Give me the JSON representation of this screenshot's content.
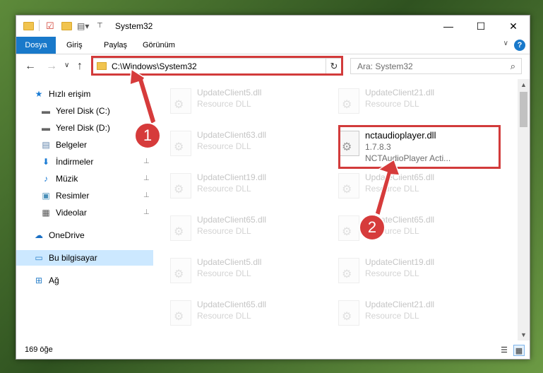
{
  "window": {
    "title": "System32",
    "minimize_glyph": "—",
    "maximize_glyph": "☐",
    "close_glyph": "✕"
  },
  "ribbon": {
    "tabs": [
      "Dosya",
      "Giriş",
      "Paylaş",
      "Görünüm"
    ],
    "help_glyph": "?",
    "toggle_glyph": "∨"
  },
  "navigation": {
    "back_glyph": "←",
    "forward_glyph": "→",
    "recent_glyph": "∨",
    "up_glyph": "↑",
    "address": "C:\\Windows\\System32",
    "address_chevron": "∨",
    "refresh_glyph": "↻",
    "search_placeholder": "Ara: System32",
    "search_glyph": "⌕"
  },
  "sidebar": {
    "items": [
      {
        "label": "Hızlı erişim",
        "icon": "star-icon",
        "glyph": "★",
        "pinned": false
      },
      {
        "label": "Yerel Disk (C:)",
        "icon": "drive-icon",
        "glyph": "▬",
        "pinned": true
      },
      {
        "label": "Yerel Disk (D:)",
        "icon": "drive-icon",
        "glyph": "▬",
        "pinned": false
      },
      {
        "label": "Belgeler",
        "icon": "documents-icon",
        "glyph": "▤",
        "pinned": true
      },
      {
        "label": "İndirmeler",
        "icon": "download-icon",
        "glyph": "⬇",
        "pinned": true
      },
      {
        "label": "Müzik",
        "icon": "music-icon",
        "glyph": "♪",
        "pinned": true
      },
      {
        "label": "Resimler",
        "icon": "pictures-icon",
        "glyph": "▣",
        "pinned": true
      },
      {
        "label": "Videolar",
        "icon": "video-icon",
        "glyph": "▦",
        "pinned": true
      },
      {
        "label": "OneDrive",
        "icon": "cloud-icon",
        "glyph": "☁",
        "pinned": false
      },
      {
        "label": "Bu bilgisayar",
        "icon": "computer-icon",
        "glyph": "▭",
        "pinned": false
      },
      {
        "label": "Ağ",
        "icon": "network-icon",
        "glyph": "⊞",
        "pinned": false
      }
    ],
    "pin_glyph": "📌"
  },
  "files": {
    "col1": [
      {
        "name": "UpdateClient5.dll",
        "desc": "Resource DLL"
      },
      {
        "name": "UpdateClient63.dll",
        "desc": "Resource DLL"
      },
      {
        "name": "UpdateClient19.dll",
        "desc": "Resource DLL"
      },
      {
        "name": "UpdateClient65.dll",
        "desc": "Resource DLL"
      },
      {
        "name": "UpdateClient5.dll",
        "desc": "Resource DLL"
      },
      {
        "name": "UpdateClient65.dll",
        "desc": "Resource DLL"
      }
    ],
    "col2": [
      {
        "name": "UpdateClient21.dll",
        "desc": "Resource DLL"
      },
      {
        "name": "UpdateClient65.dll",
        "desc": "Resource DLL"
      },
      {
        "name": "UpdateClient65.dll",
        "desc": "Resource DLL"
      },
      {
        "name": "UpdateClient19.dll",
        "desc": "Resource DLL"
      },
      {
        "name": "UpdateClient21.dll",
        "desc": "Resource DLL"
      }
    ],
    "highlighted": {
      "name": "nctaudioplayer.dll",
      "version": "1.7.8.3",
      "desc": "NCTAudioPlayer Acti..."
    },
    "gear_glyph": "⚙"
  },
  "scrollbar": {
    "up_glyph": "▲",
    "down_glyph": "▼"
  },
  "status": {
    "count": "169 öğe",
    "details_glyph": "☰",
    "tiles_glyph": "▦"
  },
  "annotations": {
    "step1": "1",
    "step2": "2",
    "color": "#d63b3b"
  }
}
